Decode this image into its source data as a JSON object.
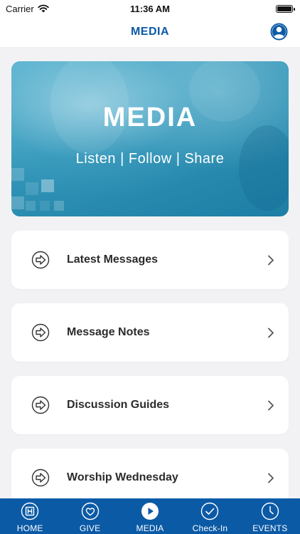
{
  "status_bar": {
    "carrier": "Carrier",
    "time": "11:36 AM"
  },
  "nav": {
    "title": "MEDIA",
    "profile_icon": "person-circle-icon"
  },
  "banner": {
    "title": "MEDIA",
    "subtitle": "Listen | Follow | Share"
  },
  "menu": {
    "items": [
      {
        "label": "Latest Messages",
        "icon": "arrow-right-circle-icon"
      },
      {
        "label": "Message Notes",
        "icon": "arrow-right-circle-icon"
      },
      {
        "label": "Discussion Guides",
        "icon": "arrow-right-circle-icon"
      },
      {
        "label": "Worship Wednesday",
        "icon": "arrow-right-circle-icon"
      }
    ]
  },
  "tabs": [
    {
      "label": "HOME",
      "icon": "home-logo-icon"
    },
    {
      "label": "GIVE",
      "icon": "heart-circle-icon"
    },
    {
      "label": "MEDIA",
      "icon": "play-circle-icon"
    },
    {
      "label": "Check-In",
      "icon": "check-circle-icon"
    },
    {
      "label": "EVENTS",
      "icon": "clock-icon"
    }
  ],
  "colors": {
    "brand": "#0b5aa6",
    "background": "#f2f2f4",
    "card": "#ffffff"
  }
}
